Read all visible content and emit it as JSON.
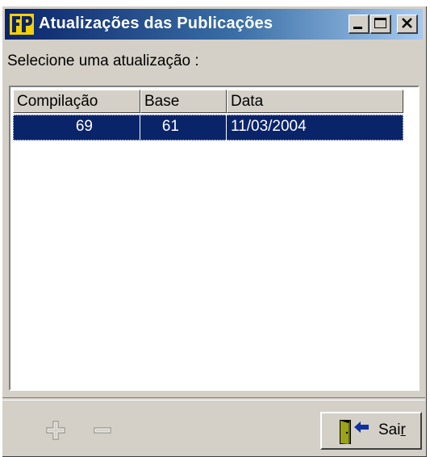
{
  "window": {
    "title": "Atualizações das Publicações"
  },
  "titlebar_buttons": {
    "minimize": "minimize",
    "maximize": "maximize",
    "close": "close"
  },
  "prompt": "Selecione uma atualização :",
  "table": {
    "columns": [
      "Compilação",
      "Base",
      "Data"
    ],
    "rows": [
      {
        "compilacao": "69",
        "base": "61",
        "data": "11/03/2004",
        "selected": true
      }
    ]
  },
  "toolbar": {
    "add_icon": "plus-icon",
    "remove_icon": "minus-icon",
    "exit_label_main": "Sai",
    "exit_label_mnemonic": "r"
  },
  "colors": {
    "selection": "#0a246a",
    "titlebar_start": "#0a246a",
    "titlebar_end": "#a6caf0",
    "face": "#d4d0c8"
  }
}
